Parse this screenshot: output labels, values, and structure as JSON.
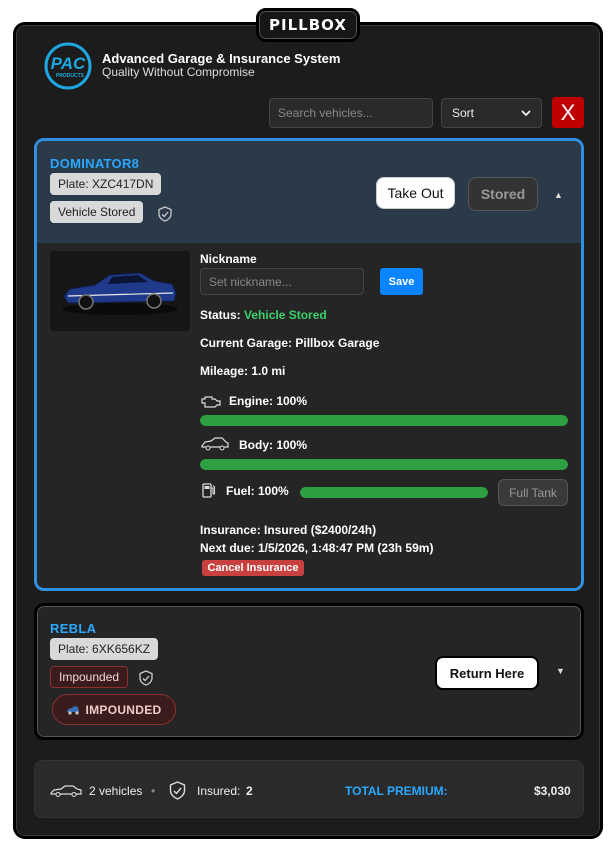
{
  "window": {
    "title": "PILLBOX"
  },
  "brand": {
    "logo_text": "PAC",
    "logo_subtext": "PRODUCTS",
    "name": "Advanced Garage & Insurance System",
    "tagline": "Quality Without Compromise"
  },
  "toolbar": {
    "search_placeholder": "Search vehicles...",
    "sort_label": "Sort",
    "close_label": "X"
  },
  "vehicles": [
    {
      "name": "DOMINATOR8",
      "plate_label": "Plate: XZC417DN",
      "state_chip": "Vehicle Stored",
      "primary_action": "Take Out",
      "secondary_action": "Stored",
      "expanded": true,
      "details": {
        "nickname_label": "Nickname",
        "nickname_placeholder": "Set nickname...",
        "save_label": "Save",
        "status_label": "Status:",
        "status_value": "Vehicle Stored",
        "garage_line": "Current Garage: Pillbox Garage",
        "mileage_line": "Mileage: 1.0 mi",
        "engine_label": "Engine: 100%",
        "engine_level": 1.0,
        "body_label": "Body: 100%",
        "body_level": 1.0,
        "fuel_label": "Fuel: 100%",
        "fuel_level": 1.0,
        "full_tank_label": "Full Tank",
        "insurance_line": "Insurance: Insured ($2400/24h)",
        "next_due_line": "Next due: 1/5/2026, 1:48:47 PM (23h 59m)",
        "cancel_insurance_label": "Cancel Insurance"
      }
    },
    {
      "name": "REBLA",
      "plate_label": "Plate: 6XK656KZ",
      "state_chip": "Impounded",
      "status_pill": "IMPOUNDED",
      "primary_action": "Return Here",
      "expanded": false
    }
  ],
  "footer": {
    "vehicle_count": "2 vehicles",
    "separator": "•",
    "insured_label": "Insured:",
    "insured_count": "2",
    "premium_label": "TOTAL PREMIUM:",
    "premium_value": "$3,030"
  },
  "colors": {
    "accent_blue": "#2aa8ff",
    "selected_border": "#2f8fe0",
    "health_green": "#2ea043",
    "close_red": "#c00000",
    "cancel_red": "#c9413f"
  }
}
